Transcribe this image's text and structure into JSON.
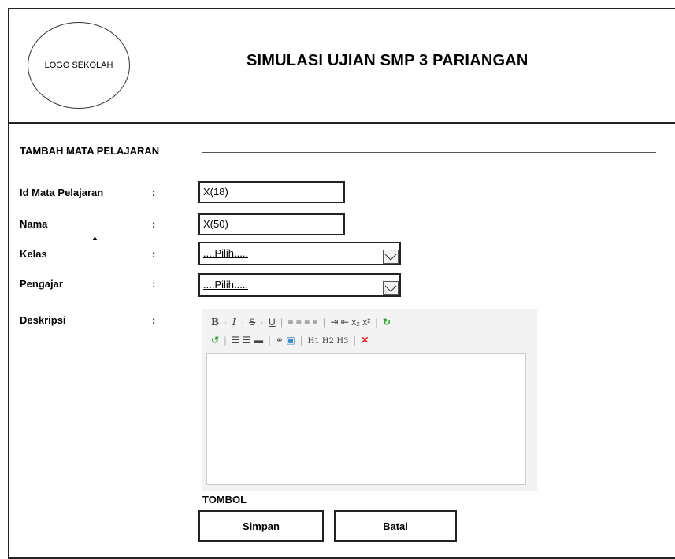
{
  "header": {
    "logo_text": "LOGO SEKOLAH",
    "title": "SIMULASI UJIAN SMP 3 PARIANGAN"
  },
  "section": {
    "title": "TAMBAH MATA PELAJARAN"
  },
  "form": {
    "colon": ":",
    "id": {
      "label": "Id Mata Pelajaran",
      "value": "X(18)"
    },
    "nama": {
      "label": "Nama",
      "value": "X(50)"
    },
    "kelas": {
      "label": "Kelas",
      "value": "....Pilih....."
    },
    "pengajar": {
      "label": "Pengajar",
      "value": "....Pilih....."
    },
    "deskripsi": {
      "label": "Deskripsi"
    }
  },
  "editor": {
    "row1": [
      "B",
      "I",
      "S",
      "U",
      "align-left",
      "align-center",
      "align-right",
      "justify",
      "indent",
      "outdent",
      "subscript",
      "superscript",
      "redo"
    ],
    "row2": [
      "undo",
      "ordered-list",
      "unordered-list",
      "horizontal-rule",
      "link",
      "image",
      "H1",
      "H2",
      "H3",
      "remove-format"
    ]
  },
  "buttons": {
    "group_label": "TOMBOL",
    "save": "Simpan",
    "cancel": "Batal"
  },
  "colors": {
    "remove_icon": "#e02020",
    "undo_icon": "#2aa02a",
    "redo_icon": "#2aa02a"
  }
}
